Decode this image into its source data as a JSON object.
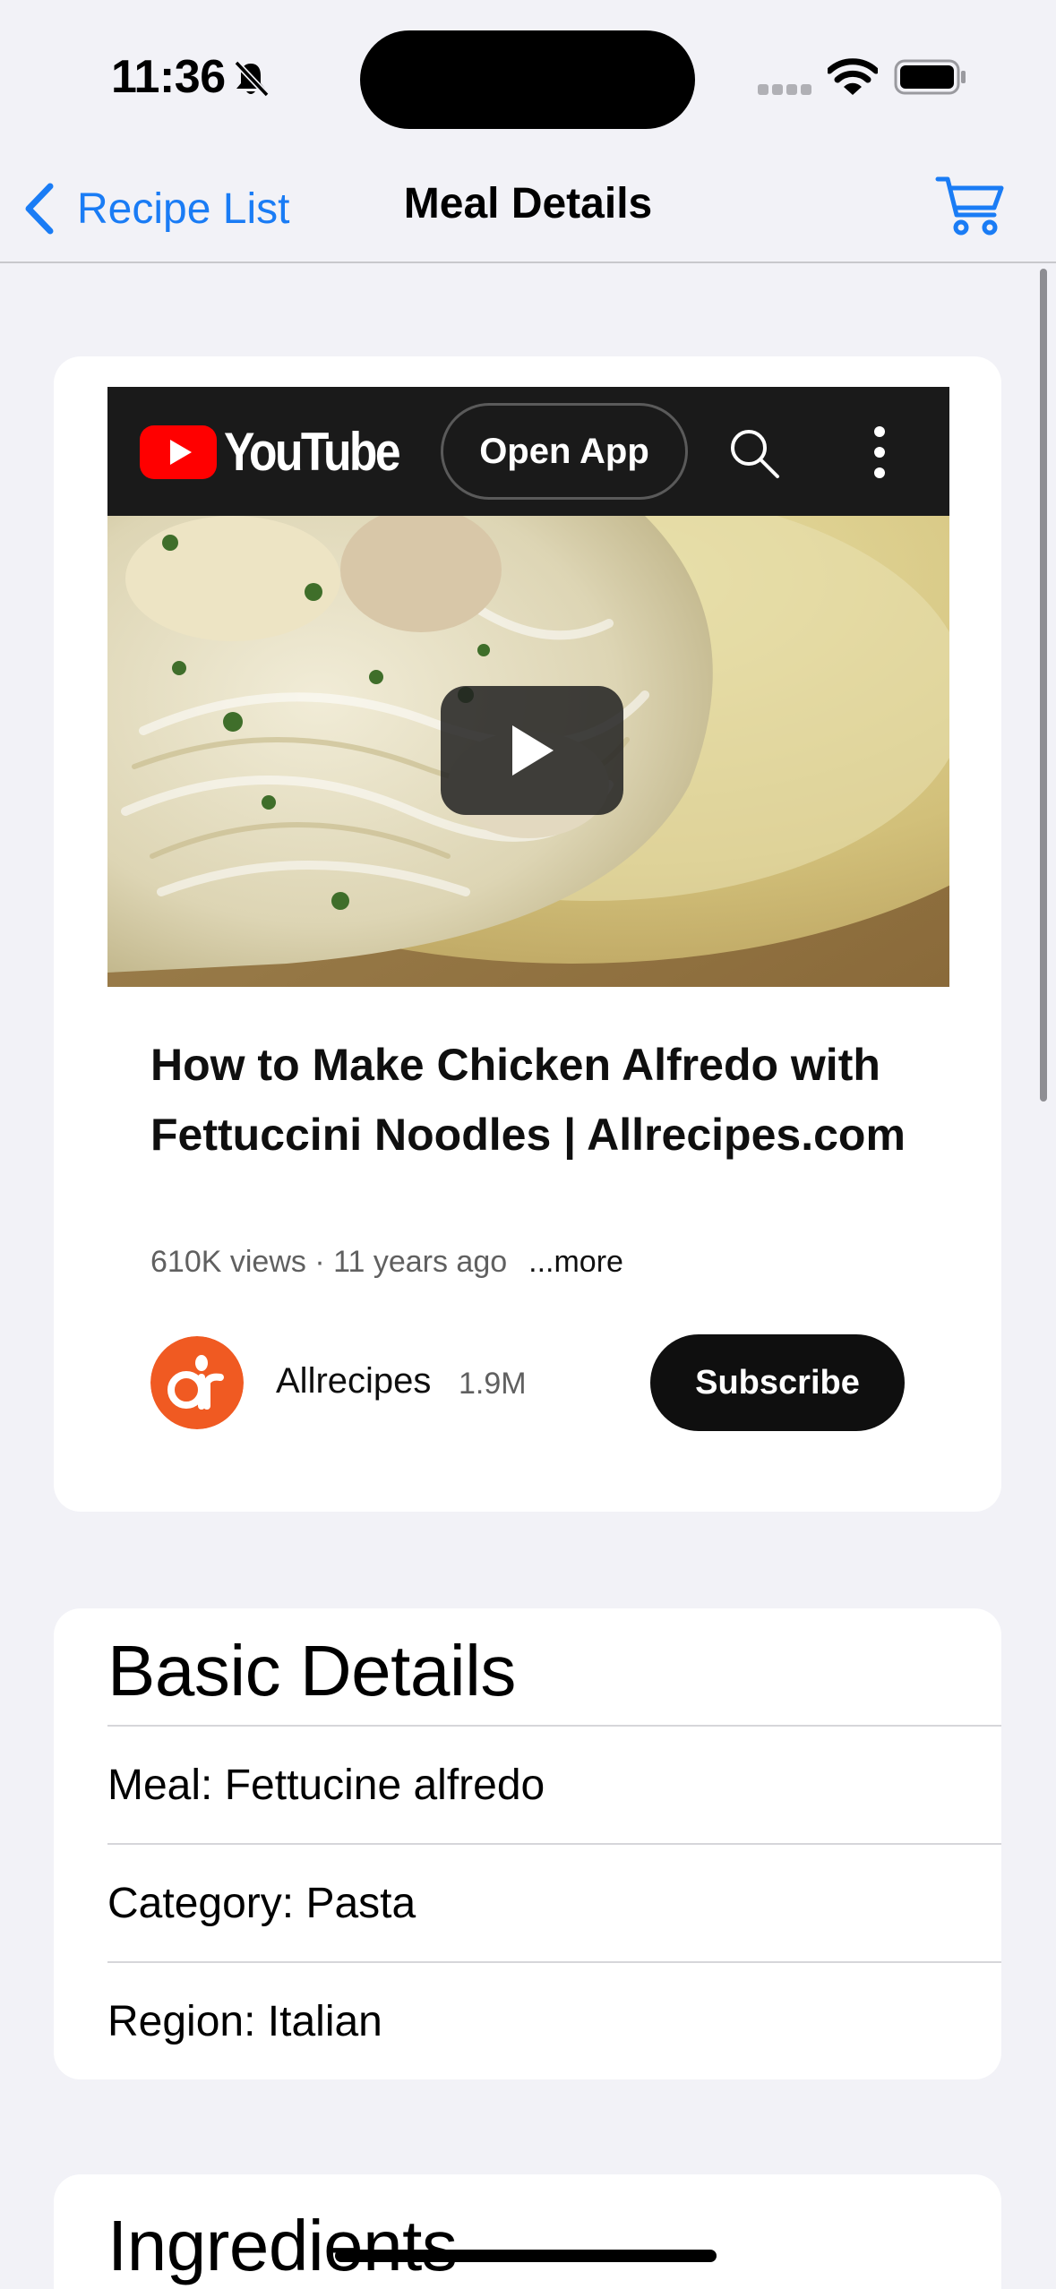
{
  "status_bar": {
    "time": "11:36"
  },
  "nav": {
    "back_label": "Recipe List",
    "title": "Meal Details"
  },
  "video": {
    "brand": "YouTube",
    "open_app_label": "Open App",
    "title": "How to Make Chicken Alfredo with Fettuccini Noodles | Allrecipes.com",
    "meta": "610K views · 11 years ago",
    "more_label": "...more",
    "channel": {
      "name": "Allrecipes",
      "subscribers": "1.9M",
      "avatar_text": "ar"
    },
    "subscribe_label": "Subscribe"
  },
  "basic_details": {
    "heading": "Basic Details",
    "rows": [
      "Meal: Fettucine alfredo",
      "Category: Pasta",
      "Region: Italian"
    ]
  },
  "ingredients": {
    "heading": "Ingredients"
  },
  "colors": {
    "accent": "#1a7cf5",
    "youtube_red": "#ff0000",
    "background": "#f2f2f7",
    "avatar_orange": "#f05a22"
  }
}
